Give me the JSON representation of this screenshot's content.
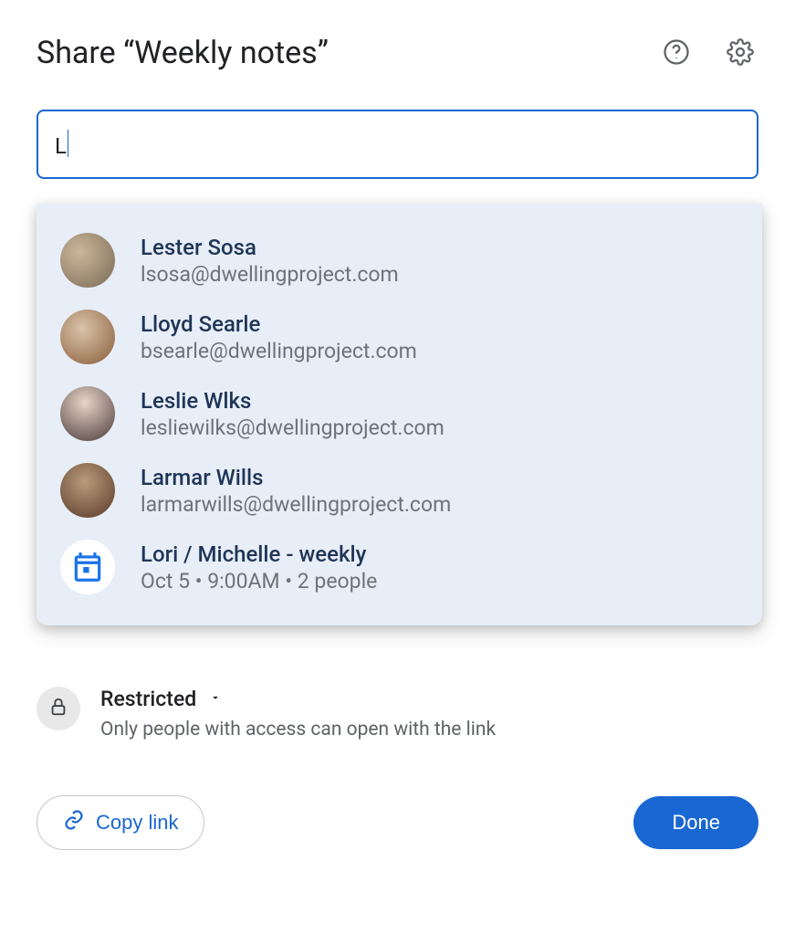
{
  "header": {
    "title": "Share “Weekly notes”"
  },
  "search": {
    "value": "L"
  },
  "suggestions": [
    {
      "name": "Lester Sosa",
      "detail": "lsosa@dwellingproject.com",
      "type": "person",
      "avatar_class": "av1"
    },
    {
      "name": "Lloyd Searle",
      "detail": "bsearle@dwellingproject.com",
      "type": "person",
      "avatar_class": "av2"
    },
    {
      "name": "Leslie Wlks",
      "detail": "lesliewilks@dwellingproject.com",
      "type": "person",
      "avatar_class": "av3"
    },
    {
      "name": "Larmar Wills",
      "detail": "larmarwills@dwellingproject.com",
      "type": "person",
      "avatar_class": "av4"
    },
    {
      "name": "Lori / Michelle - weekly",
      "detail": "Oct 5 • 9:00AM • 2 people",
      "type": "event"
    }
  ],
  "access": {
    "label": "Restricted",
    "description": "Only people with access can open with the link"
  },
  "footer": {
    "copy_link_label": "Copy link",
    "done_label": "Done"
  }
}
